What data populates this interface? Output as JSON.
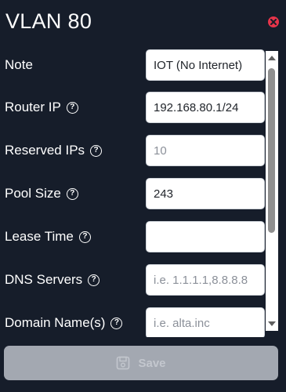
{
  "dialog": {
    "title": "VLAN 80"
  },
  "fields": [
    {
      "label": "Note",
      "value": "IOT (No Internet)",
      "placeholder": "",
      "help": false
    },
    {
      "label": "Router IP",
      "value": "192.168.80.1/24",
      "placeholder": "",
      "help": true
    },
    {
      "label": "Reserved IPs",
      "value": "",
      "placeholder": "10",
      "help": true
    },
    {
      "label": "Pool Size",
      "value": "243",
      "placeholder": "",
      "help": true
    },
    {
      "label": "Lease Time",
      "value": "",
      "placeholder": "",
      "help": true
    },
    {
      "label": "DNS Servers",
      "value": "",
      "placeholder": "i.e. 1.1.1.1,8.8.8.8",
      "help": true
    },
    {
      "label": "Domain Name(s)",
      "value": "",
      "placeholder": "i.e. alta.inc",
      "help": true
    }
  ],
  "help_glyph": "?",
  "save_button": {
    "label": "Save",
    "enabled": false
  },
  "icons": {
    "close": "close-icon",
    "save": "save-disk-icon",
    "help": "help-icon"
  },
  "colors": {
    "background": "#161d2a",
    "close": "#e6344a",
    "save_disabled": "#a3a8b1"
  }
}
